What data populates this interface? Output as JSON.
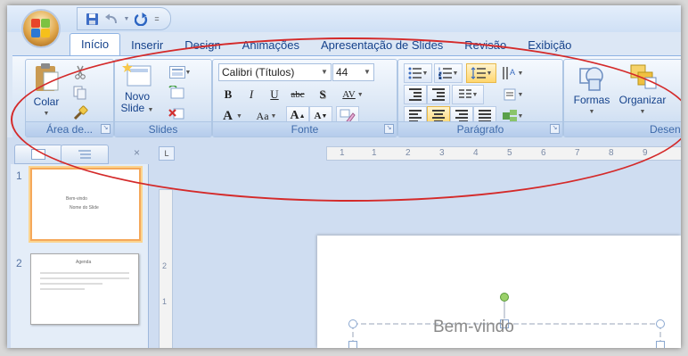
{
  "quick_access": {
    "save_icon": "save-icon",
    "undo_icon": "undo-icon",
    "redo_icon": "redo-icon",
    "customize_icon": "dropdown-icon"
  },
  "tabs": [
    {
      "label": "Início",
      "active": true
    },
    {
      "label": "Inserir"
    },
    {
      "label": "Design"
    },
    {
      "label": "Animações"
    },
    {
      "label": "Apresentação de Slides"
    },
    {
      "label": "Revisão"
    },
    {
      "label": "Exibição"
    }
  ],
  "ribbon": {
    "clipboard": {
      "title": "Área de...",
      "paste_label": "Colar"
    },
    "slides": {
      "title": "Slides",
      "new_slide_label_1": "Novo",
      "new_slide_label_2": "Slide"
    },
    "font": {
      "title": "Fonte",
      "font_name": "Calibri (Títulos)",
      "font_size": "44",
      "bold": "B",
      "italic": "I",
      "underline": "U",
      "strike": "abc",
      "shadow": "S",
      "spacing": "AV",
      "color": "A",
      "case": "Aa",
      "grow": "A",
      "shrink": "A"
    },
    "paragraph": {
      "title": "Parágrafo"
    },
    "drawing": {
      "title": "Desenho",
      "shapes_label": "Formas",
      "arrange_label": "Organizar"
    }
  },
  "ruler": {
    "h_labels": [
      "1",
      "1",
      "2",
      "3",
      "4",
      "5",
      "6",
      "7",
      "8",
      "9"
    ],
    "v_labels": [
      "2",
      "1"
    ]
  },
  "thumbnails": [
    {
      "number": "1",
      "title": "Bem-vindo",
      "subtitle": "Nome do Slide"
    },
    {
      "number": "2",
      "title": "Agenda"
    }
  ],
  "slide": {
    "title_text": "Bem-vindo"
  },
  "colors": {
    "annotation_ellipse": "#d42a2a",
    "font_color_bar": "#e21d1d",
    "accent": "#15428b"
  }
}
